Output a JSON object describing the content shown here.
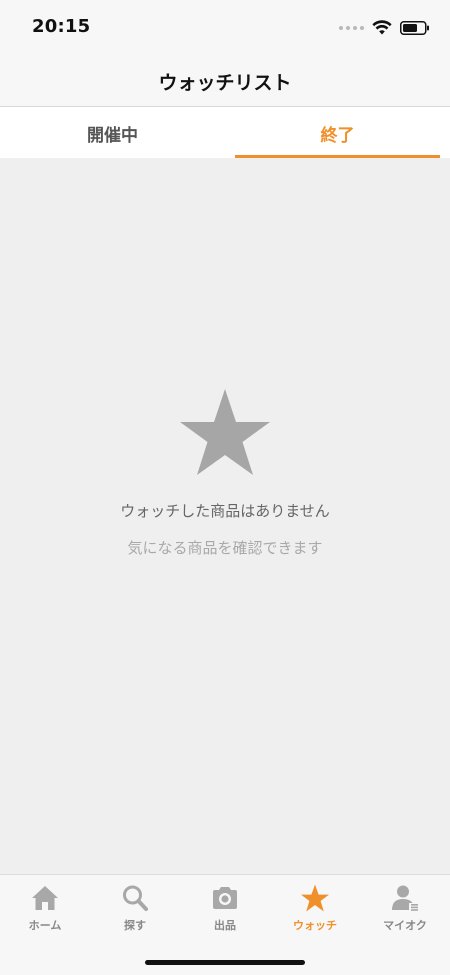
{
  "status_bar": {
    "time": "20:15"
  },
  "header": {
    "title": "ウォッチリスト"
  },
  "tabs": [
    {
      "label": "開催中",
      "active": false
    },
    {
      "label": "終了",
      "active": true
    }
  ],
  "empty_state": {
    "icon": "star-icon",
    "title": "ウォッチした商品はありません",
    "subtitle": "気になる商品を確認できます"
  },
  "bottom_nav": {
    "items": [
      {
        "label": "ホーム",
        "icon": "home-icon",
        "active": false
      },
      {
        "label": "探す",
        "icon": "search-icon",
        "active": false
      },
      {
        "label": "出品",
        "icon": "camera-icon",
        "active": false
      },
      {
        "label": "ウォッチ",
        "icon": "star-icon",
        "active": true
      },
      {
        "label": "マイオク",
        "icon": "user-icon",
        "active": false
      }
    ]
  },
  "colors": {
    "accent": "#f0902a",
    "background": "#efefef",
    "icon_gray": "#a8a8a8",
    "star_gray": "#a6a6a6"
  }
}
